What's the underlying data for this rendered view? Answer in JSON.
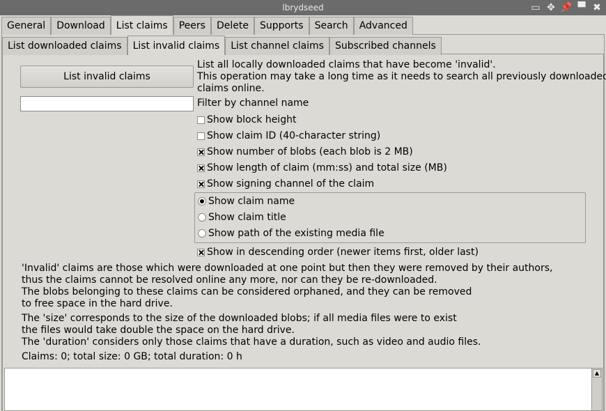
{
  "window": {
    "title": "lbrydseed",
    "icons": [
      "minimize-icon",
      "move-icon",
      "pin-icon",
      "maximize-icon",
      "close-icon"
    ]
  },
  "tabs": [
    "General",
    "Download",
    "List claims",
    "Peers",
    "Delete",
    "Supports",
    "Search",
    "Advanced"
  ],
  "active_tab": "List claims",
  "subtabs": [
    "List downloaded claims",
    "List invalid claims",
    "List channel claims",
    "Subscribed channels"
  ],
  "active_subtab": "List invalid claims",
  "list_button_label": "List invalid claims",
  "description": [
    "List all locally downloaded claims that have become 'invalid'.",
    "This operation may take a long time as it needs to search all previously downloaded",
    "claims online."
  ],
  "filter": {
    "value": "",
    "label": "Filter by channel name"
  },
  "checkboxes": [
    {
      "label": "Show block height",
      "checked": false
    },
    {
      "label": "Show claim ID (40-character string)",
      "checked": false
    },
    {
      "label": "Show number of blobs (each blob is 2 MB)",
      "checked": true
    },
    {
      "label": "Show length of claim (mm:ss) and total size (MB)",
      "checked": true
    },
    {
      "label": "Show signing channel of the claim",
      "checked": true
    }
  ],
  "radios": [
    {
      "label": "Show claim name",
      "checked": true
    },
    {
      "label": "Show claim title",
      "checked": false
    },
    {
      "label": "Show path of the existing media file",
      "checked": false
    }
  ],
  "descending": {
    "label": "Show in descending order (newer items first, older last)",
    "checked": true
  },
  "info_paragraph_1": [
    "'Invalid' claims are those which were downloaded at one point but then they were removed by their authors,",
    "thus the claims cannot be resolved online any more, nor can they be re-downloaded.",
    "The blobs belonging to these claims can be considered orphaned, and they can be removed",
    "to free space in the hard drive."
  ],
  "info_paragraph_2": [
    "The 'size' corresponds to the size of the downloaded blobs; if all media files were to exist",
    "the files would take double the space on the hard drive.",
    "The 'duration' considers only those claims that have a duration, such as video and audio files."
  ],
  "summary": "Claims: 0; total size: 0 GB; total duration: 0 h",
  "output_text": ""
}
